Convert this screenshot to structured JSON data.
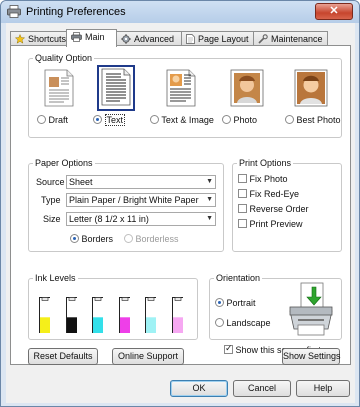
{
  "window": {
    "title": "Printing Preferences",
    "close_glyph": "✕"
  },
  "tabs": [
    {
      "label": "Shortcuts",
      "icon": "star-icon"
    },
    {
      "label": "Main",
      "icon": "printer-icon"
    },
    {
      "label": "Advanced",
      "icon": "gear-icon"
    },
    {
      "label": "Page Layout",
      "icon": "page-icon"
    },
    {
      "label": "Maintenance",
      "icon": "wrench-icon"
    }
  ],
  "active_tab": "Main",
  "quality": {
    "legend": "Quality Option",
    "options": [
      {
        "label": "Draft",
        "selected": false
      },
      {
        "label": "Text",
        "selected": true
      },
      {
        "label": "Text & Image",
        "selected": false
      },
      {
        "label": "Photo",
        "selected": false
      },
      {
        "label": "Best Photo",
        "selected": false
      }
    ]
  },
  "paper": {
    "legend": "Paper Options",
    "source_label": "Source",
    "source_value": "Sheet",
    "type_label": "Type",
    "type_value": "Plain Paper / Bright White Paper",
    "size_label": "Size",
    "size_value": "Letter (8 1/2 x 11 in)",
    "borders_label": "Borders",
    "borderless_label": "Borderless",
    "borders_selected": true
  },
  "print_options": {
    "legend": "Print Options",
    "items": [
      {
        "label": "Fix Photo",
        "checked": false
      },
      {
        "label": "Fix Red-Eye",
        "checked": false
      },
      {
        "label": "Reverse Order",
        "checked": false
      },
      {
        "label": "Print Preview",
        "checked": false
      }
    ]
  },
  "ink": {
    "legend": "Ink Levels",
    "cartridges": [
      {
        "color": "#f5ef1a",
        "level": 0.45
      },
      {
        "color": "#111111",
        "level": 0.45
      },
      {
        "color": "#33e0ea",
        "level": 0.45
      },
      {
        "color": "#ee3fe8",
        "level": 0.45
      },
      {
        "color": "#9ff2f5",
        "level": 0.45
      },
      {
        "color": "#f6a8f2",
        "level": 0.45
      }
    ]
  },
  "orientation": {
    "legend": "Orientation",
    "portrait_label": "Portrait",
    "landscape_label": "Landscape",
    "portrait_selected": true
  },
  "show_screen": {
    "label": "Show this screen first",
    "checked": true
  },
  "buttons": {
    "reset": "Reset Defaults",
    "online_support": "Online Support",
    "show_settings": "Show Settings",
    "ok": "OK",
    "cancel": "Cancel",
    "help": "Help"
  }
}
